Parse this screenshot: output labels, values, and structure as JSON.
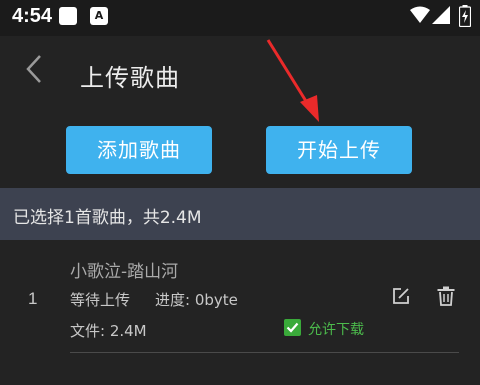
{
  "status_bar": {
    "time": "4:54",
    "notification_icons": [
      "square-icon",
      "a-app-icon"
    ],
    "system_icons": [
      "wifi-icon",
      "signal-icon",
      "battery-charging-icon"
    ]
  },
  "header": {
    "title": "上传歌曲",
    "back_icon": "chevron-left-icon"
  },
  "actions": {
    "add_label": "添加歌曲",
    "start_label": "开始上传"
  },
  "summary": {
    "text": "已选择1首歌曲，共2.4M"
  },
  "songs": [
    {
      "index": "1",
      "title": "小歌泣-踏山河",
      "status": "等待上传",
      "progress": "进度: 0byte",
      "file": "文件: 2.4M",
      "allow_download_label": "允许下载",
      "allow_download": true
    }
  ],
  "colors": {
    "accent": "#3fb2ee",
    "summary_bg": "#3d4250",
    "background": "#232323",
    "checkbox": "#3aaa3a",
    "annotation_arrow": "#ea2a2a"
  }
}
